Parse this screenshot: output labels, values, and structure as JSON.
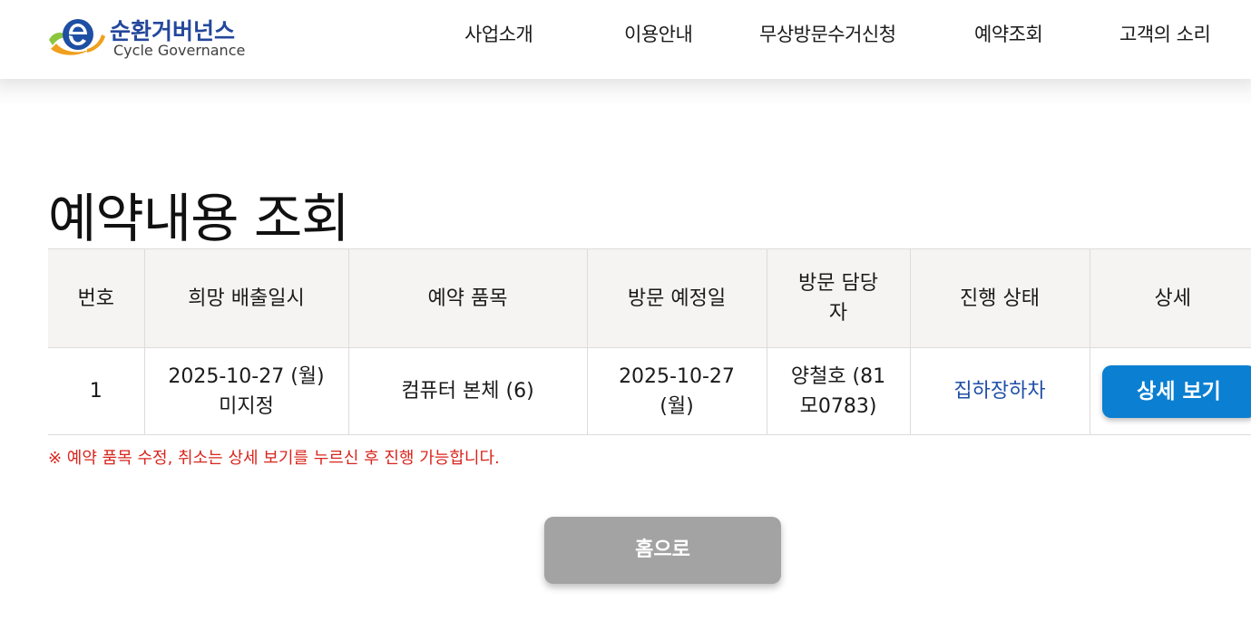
{
  "header": {
    "logo_kr": "순환거버넌스",
    "logo_en": "Cycle Governance",
    "nav": [
      {
        "label": "사업소개"
      },
      {
        "label": "이용안내"
      },
      {
        "label": "무상방문수거신청"
      },
      {
        "label": "예약조회"
      },
      {
        "label": "고객의 소리"
      }
    ]
  },
  "page": {
    "title": "예약내용 조회"
  },
  "table": {
    "headers": {
      "no": "번호",
      "desired_date": "희망 배출일시",
      "item": "예약 품목",
      "visit_date": "방문 예정일",
      "staff_line1": "방문 담당",
      "staff_line2": "자",
      "status": "진행 상태",
      "detail": "상세"
    },
    "rows": [
      {
        "no": "1",
        "desired_date_line1": "2025-10-27 (월)",
        "desired_date_line2": "미지정",
        "item": "컴퓨터 본체 (6)",
        "visit_date_line1": "2025-10-27",
        "visit_date_line2": "(월)",
        "staff_line1": "양철호 (81",
        "staff_line2": "모0783)",
        "status": "집하장하차",
        "detail_button": "상세 보기"
      }
    ]
  },
  "notice": "※ 예약 품목 수정, 취소는 상세 보기를 누르신 후 진행 가능합니다.",
  "home_button": "홈으로",
  "colors": {
    "brand_blue": "#23479b",
    "detail_button": "#0b7fd1",
    "status_link": "#1f4fa6",
    "notice_red": "#d9251d",
    "home_button": "#a3a3a3"
  }
}
